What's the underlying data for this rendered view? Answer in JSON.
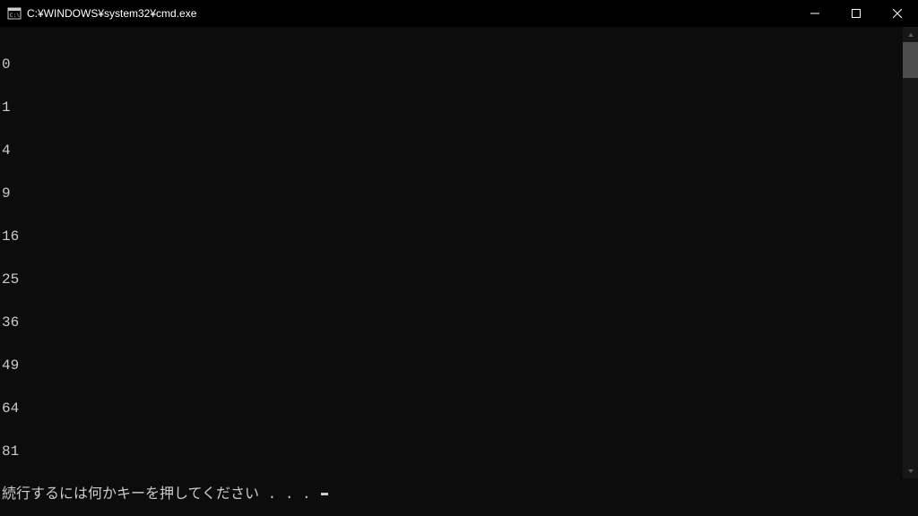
{
  "window": {
    "title": "C:¥WINDOWS¥system32¥cmd.exe"
  },
  "output": {
    "lines": [
      "0",
      "1",
      "4",
      "9",
      "16",
      "25",
      "36",
      "49",
      "64",
      "81"
    ],
    "prompt": "続行するには何かキーを押してください . . . "
  }
}
